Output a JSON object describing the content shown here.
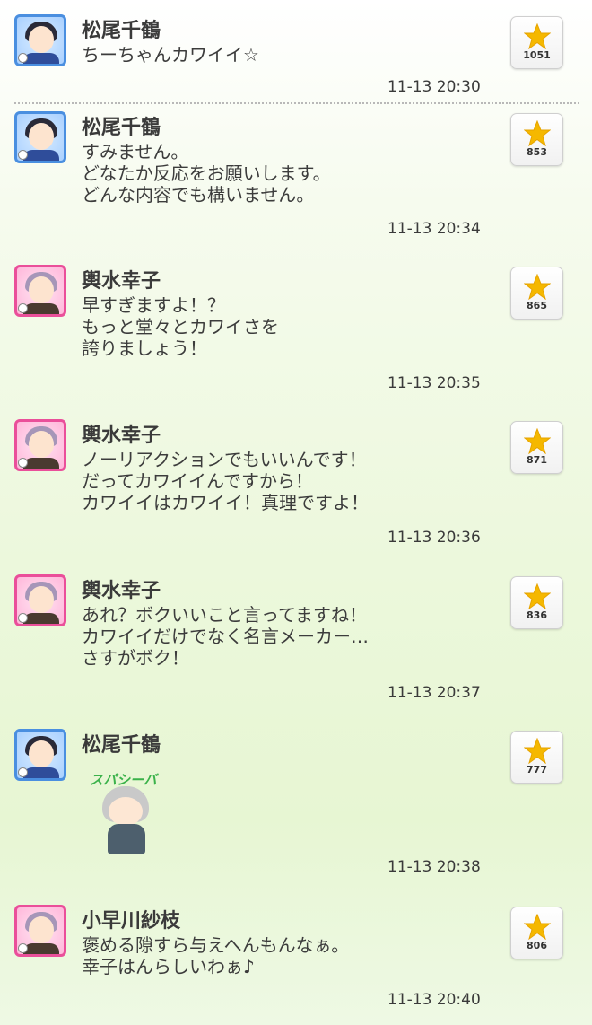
{
  "posts": [
    {
      "author": "松尾千鶴",
      "lines": [
        "ちーちゃんカワイイ☆"
      ],
      "time": "11-13 20:30",
      "likes": "1051",
      "avatar": "blue"
    },
    {
      "author": "松尾千鶴",
      "lines": [
        "すみません。",
        "どなたか反応をお願いします。",
        "どんな内容でも構いません。"
      ],
      "time": "11-13 20:34",
      "likes": "853",
      "avatar": "blue"
    },
    {
      "author": "輿水幸子",
      "lines": [
        "早すぎますよ！？",
        "もっと堂々とカワイさを",
        "誇りましょう！"
      ],
      "time": "11-13 20:35",
      "likes": "865",
      "avatar": "pink"
    },
    {
      "author": "輿水幸子",
      "lines": [
        "ノーリアクションでもいいんです！",
        "だってカワイイんですから！",
        "カワイイはカワイイ！真理ですよ！"
      ],
      "time": "11-13 20:36",
      "likes": "871",
      "avatar": "pink"
    },
    {
      "author": "輿水幸子",
      "lines": [
        "あれ？ボクいいこと言ってますね！",
        "カワイイだけでなく名言メーカー…",
        "さすがボク！"
      ],
      "time": "11-13 20:37",
      "likes": "836",
      "avatar": "pink"
    },
    {
      "author": "松尾千鶴",
      "sticker_text": "スパシーバ",
      "time": "11-13 20:38",
      "likes": "777",
      "avatar": "blue"
    },
    {
      "author": "小早川紗枝",
      "lines": [
        "褒める隙すら与えへんもんなぁ。",
        "幸子はんらしいわぁ♪"
      ],
      "time": "11-13 20:40",
      "likes": "806",
      "avatar": "pink"
    }
  ],
  "colors": {
    "star": "#f5b800",
    "blue_frame": "#4a8fe0",
    "pink_frame": "#ea4f9a"
  }
}
